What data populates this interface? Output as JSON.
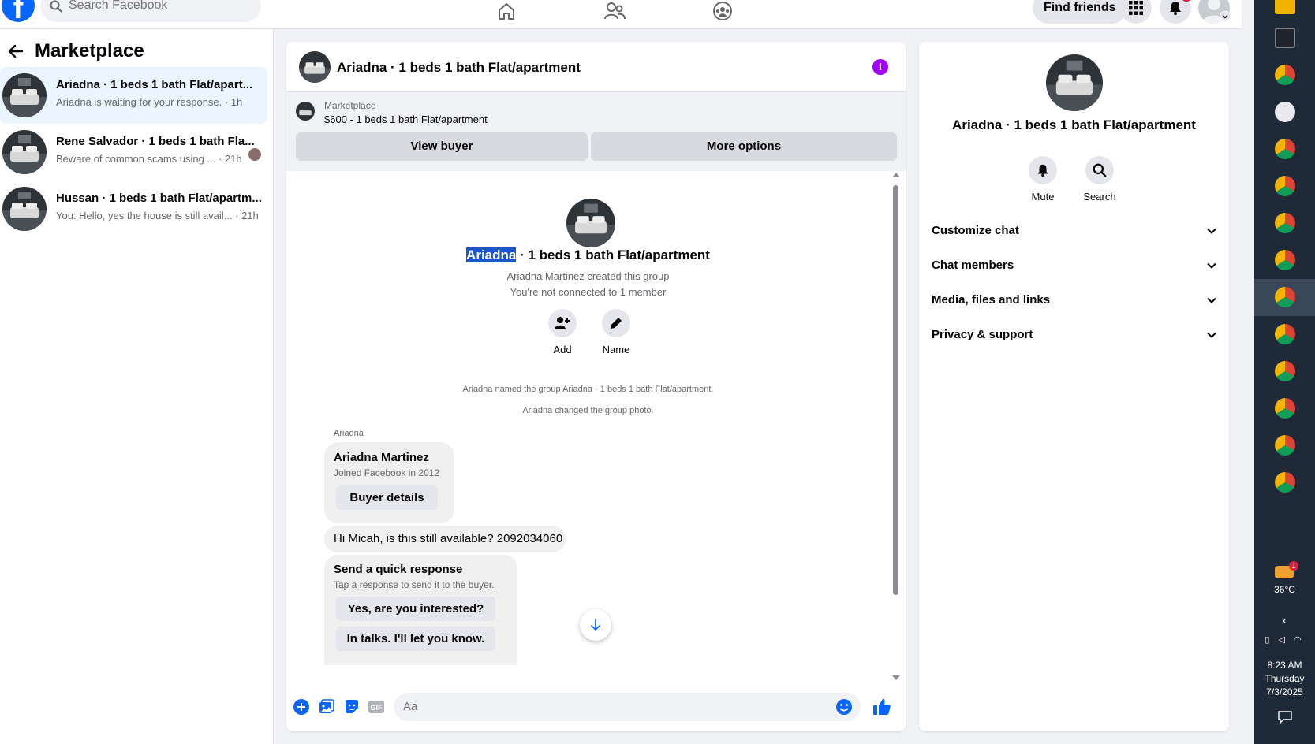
{
  "topbar": {
    "search_placeholder": "Search Facebook",
    "find_friends": "Find friends"
  },
  "sidebar": {
    "title": "Marketplace",
    "conversations": [
      {
        "title": "Ariadna · 1 beds 1 bath Flat/apart...",
        "subtitle": "Ariadna is waiting for your response. · 1h"
      },
      {
        "title": "Rene Salvador · 1 beds 1 bath Fla...",
        "subtitle": "Beware of common scams using ... · 21h"
      },
      {
        "title": "Hussan · 1 beds 1 bath Flat/apartm...",
        "subtitle": "You: Hello, yes the house is still avail... · 21h"
      }
    ]
  },
  "chat": {
    "header_title": "Ariadna · 1 beds 1 bath Flat/apartment",
    "marketplace_label": "Marketplace",
    "listing": "$600 - 1 beds 1 bath Flat/apartment",
    "view_buyer": "View buyer",
    "more_options": "More options",
    "group_title_highlight": "Ariadna",
    "group_title_rest": " · 1 beds 1 bath Flat/apartment",
    "created_by": "Ariadna Martinez created this group",
    "not_connected": "You're not connected to 1 member",
    "add_label": "Add",
    "name_label": "Name",
    "sys_named": "Ariadna named the group Ariadna · 1 beds 1 bath Flat/apartment.",
    "sys_photo": "Ariadna changed the group photo.",
    "sender": "Ariadna",
    "buyer_name": "Ariadna Martinez",
    "buyer_joined": "Joined Facebook in 2012",
    "buyer_details": "Buyer details",
    "message": "Hi Micah, is this still available? 2092034060",
    "quick_title": "Send a quick response",
    "quick_sub": "Tap a response to send it to the buyer.",
    "quick_1": "Yes, are you interested?",
    "quick_2": "In talks. I'll let you know.",
    "composer_placeholder": "Aa"
  },
  "right_panel": {
    "title": "Ariadna · 1 beds 1 bath Flat/apartment",
    "mute": "Mute",
    "search": "Search",
    "sections": [
      "Customize chat",
      "Chat members",
      "Media, files and links",
      "Privacy & support"
    ]
  },
  "taskbar": {
    "weather": "36°C",
    "time": "8:23 AM",
    "day": "Thursday",
    "date": "7/3/2025",
    "weather_badge": "1"
  },
  "colors": {
    "brand": "#0866ff",
    "info": "#a200ff",
    "highlight": "#1a56c4"
  }
}
